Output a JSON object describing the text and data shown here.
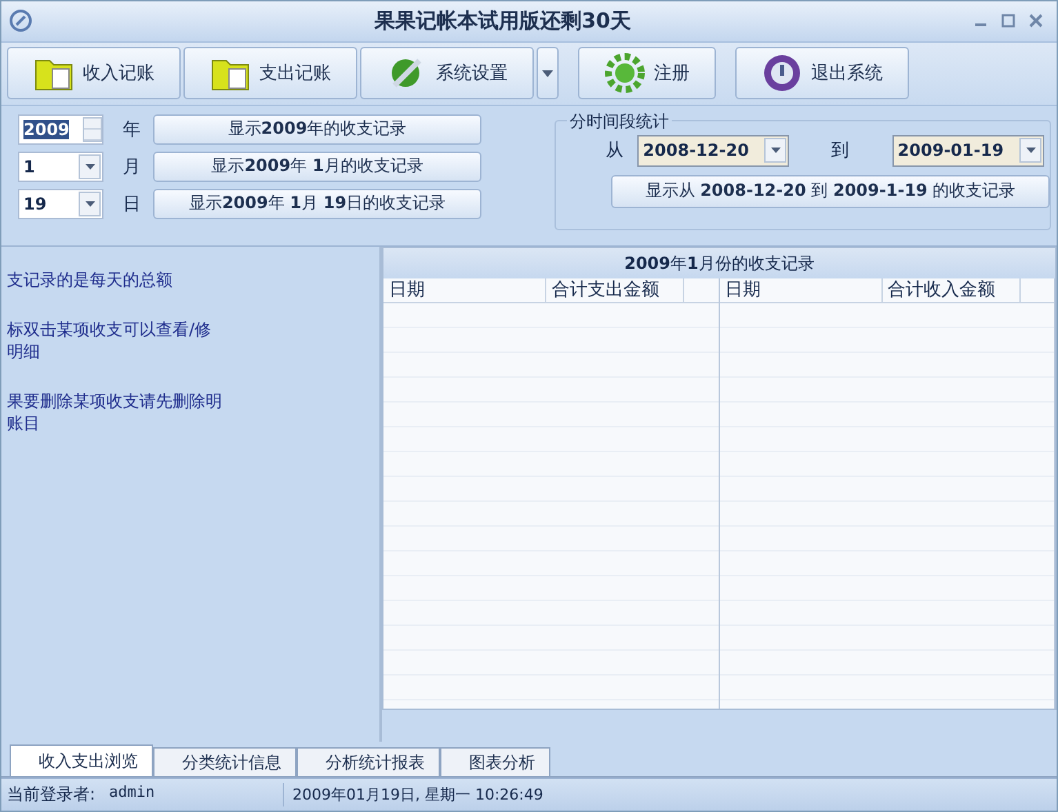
{
  "window": {
    "title": "果果记帐本试用版还剩30天"
  },
  "toolbar": [
    {
      "kind": "folder",
      "label": "收入记账"
    },
    {
      "kind": "folder",
      "label": "支出记账"
    },
    {
      "kind": "tools",
      "label": "系统设置"
    },
    {
      "kind": "dropdown"
    },
    {
      "kind": "gear",
      "label": "注册"
    },
    {
      "kind": "power",
      "label": "退出系统"
    }
  ],
  "date_pickers": [
    {
      "kind": "spinner",
      "value": "2009",
      "selected": true,
      "unit": "年",
      "button": "显示**2009**年的收支记录"
    },
    {
      "kind": "combo",
      "value": "1",
      "selected": false,
      "unit": "月",
      "button": "显示**2009**年 **1**月的收支记录"
    },
    {
      "kind": "combo",
      "value": "19",
      "selected": false,
      "unit": "日",
      "button": "显示**2009**年 **1**月 **19**日的收支记录"
    }
  ],
  "period": {
    "title": "分时间段统计",
    "from_label": "从",
    "from": "2008-12-20",
    "to_label": "到",
    "to": "2009-01-19",
    "button": "显示从 **2008-12-20** 到 **2009-1-19** 的收支记录"
  },
  "notes": [
    [
      "支记录的是每天的总额"
    ],
    [
      "标双击某项收支可以查看/修",
      "明细"
    ],
    [
      "果要删除某项收支请先删除明",
      "账目"
    ]
  ],
  "grid": {
    "caption": "**2009**年**1**月份的收支记录",
    "tables": [
      {
        "columns": [
          "日期",
          "合计支出金额"
        ]
      },
      {
        "columns": [
          "日期",
          "合计收入金额"
        ]
      }
    ]
  },
  "tabs": [
    {
      "label": "收入支出浏览",
      "selected": true
    },
    {
      "label": "分类统计信息",
      "selected": false
    },
    {
      "label": "分析统计报表",
      "selected": false
    },
    {
      "label": "图表分析",
      "selected": false
    }
  ],
  "status_bar": {
    "user_label": "当前登录者:",
    "user": "admin",
    "datetime": "2009年01月19日, 星期一 10:26:49"
  }
}
